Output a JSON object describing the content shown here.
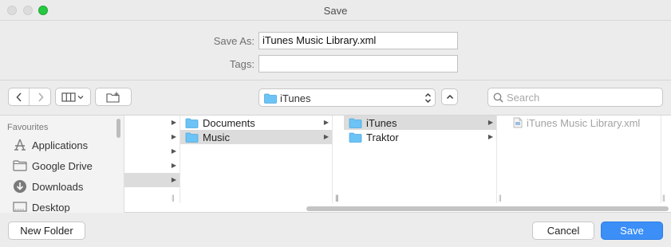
{
  "window": {
    "title": "Save"
  },
  "form": {
    "save_as_label": "Save As:",
    "save_as_value": "iTunes Music Library.xml",
    "tags_label": "Tags:",
    "tags_value": ""
  },
  "toolbar": {
    "path_label": "iTunes",
    "search_placeholder": "Search"
  },
  "sidebar": {
    "heading": "Favourites",
    "items": [
      {
        "label": "Applications",
        "icon": "applications-icon"
      },
      {
        "label": "Google Drive",
        "icon": "folder-icon"
      },
      {
        "label": "Downloads",
        "icon": "downloads-icon"
      },
      {
        "label": "Desktop",
        "icon": "desktop-icon"
      }
    ]
  },
  "columns": {
    "col2": [
      "Documents",
      "Music"
    ],
    "col3": [
      "iTunes",
      "Traktor"
    ],
    "col4": [
      "iTunes Music Library.xml"
    ]
  },
  "buttons": {
    "new_folder": "New Folder",
    "cancel": "Cancel",
    "save": "Save"
  },
  "colors": {
    "accent": "#3b8ff7",
    "folder": "#6cc3f5",
    "zoom": "#27c840"
  }
}
